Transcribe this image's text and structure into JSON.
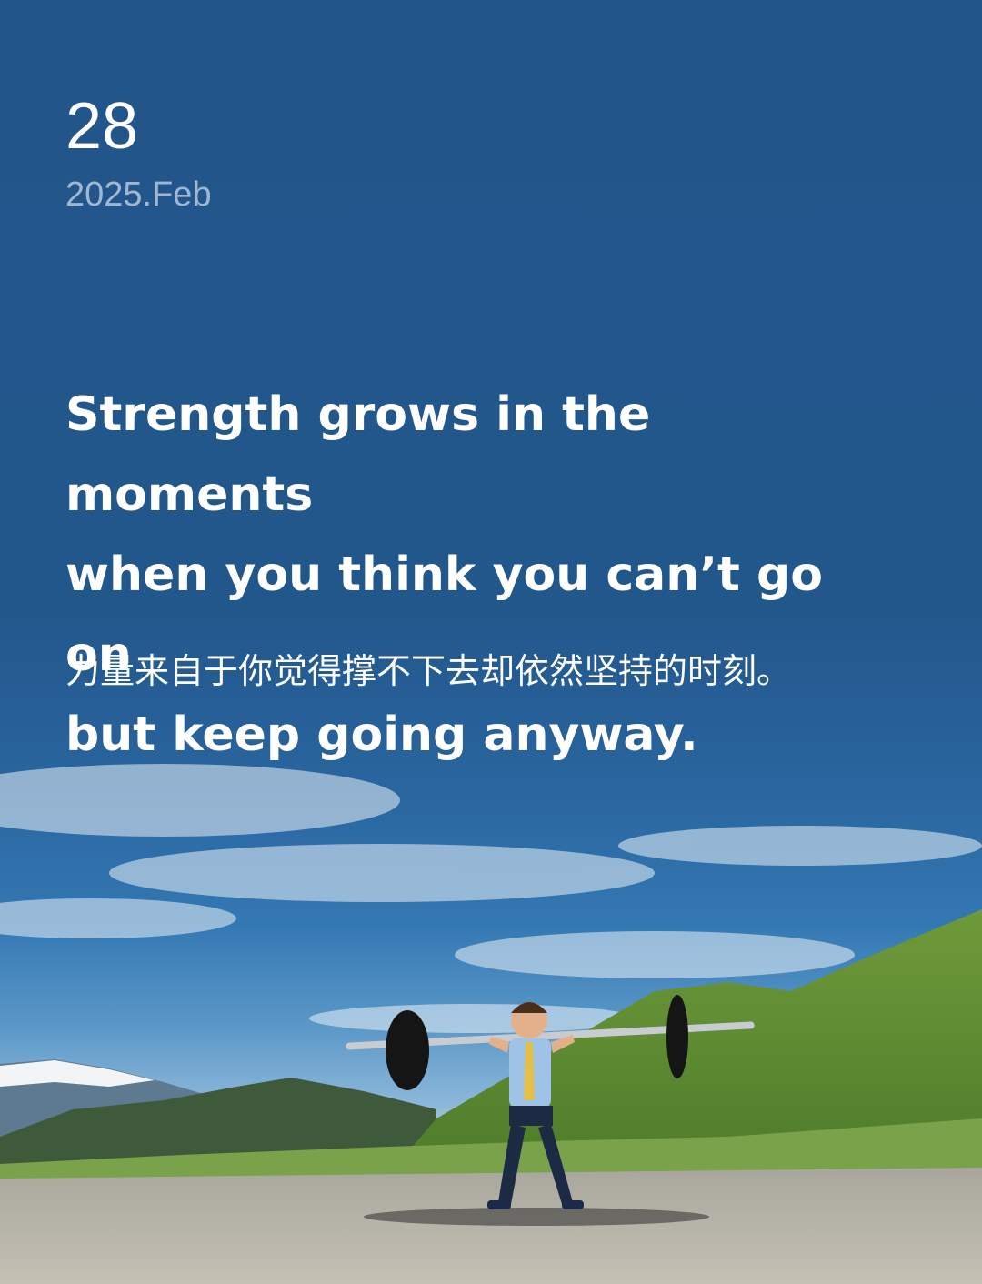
{
  "date": {
    "day": "28",
    "year_month": "2025.Feb"
  },
  "quote": {
    "lines": [
      "Strength grows in the moments",
      "when you think you can’t go on",
      "but keep going anyway."
    ],
    "translation": "力量来自于你觉得撑不下去却依然坚持的时刻。"
  },
  "colors": {
    "background": "#22578c",
    "primary_text": "#ffffff",
    "secondary_text": "#9fb7d1"
  }
}
